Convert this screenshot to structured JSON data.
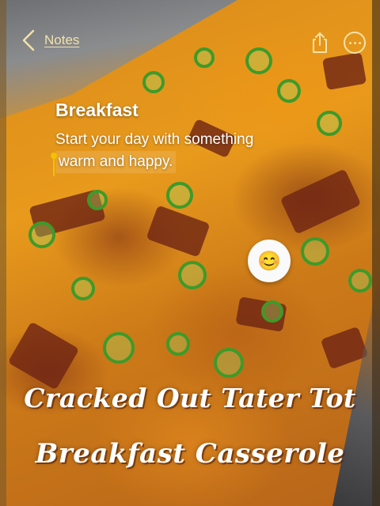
{
  "nav": {
    "back_label": "Notes",
    "icons": {
      "back": "chevron-left-icon",
      "share": "share-icon",
      "more": "more-icon"
    },
    "accent_color": "#F3E1A8"
  },
  "note": {
    "title": "Breakfast",
    "body_line1": "Start your day with something",
    "body_line2": "warm and happy.",
    "cursor_color": "#F2C200"
  },
  "sticker": {
    "emoji": "😊"
  },
  "headline": {
    "line1": "Cracked Out Tater Tot",
    "line2": "Breakfast Casserole"
  }
}
